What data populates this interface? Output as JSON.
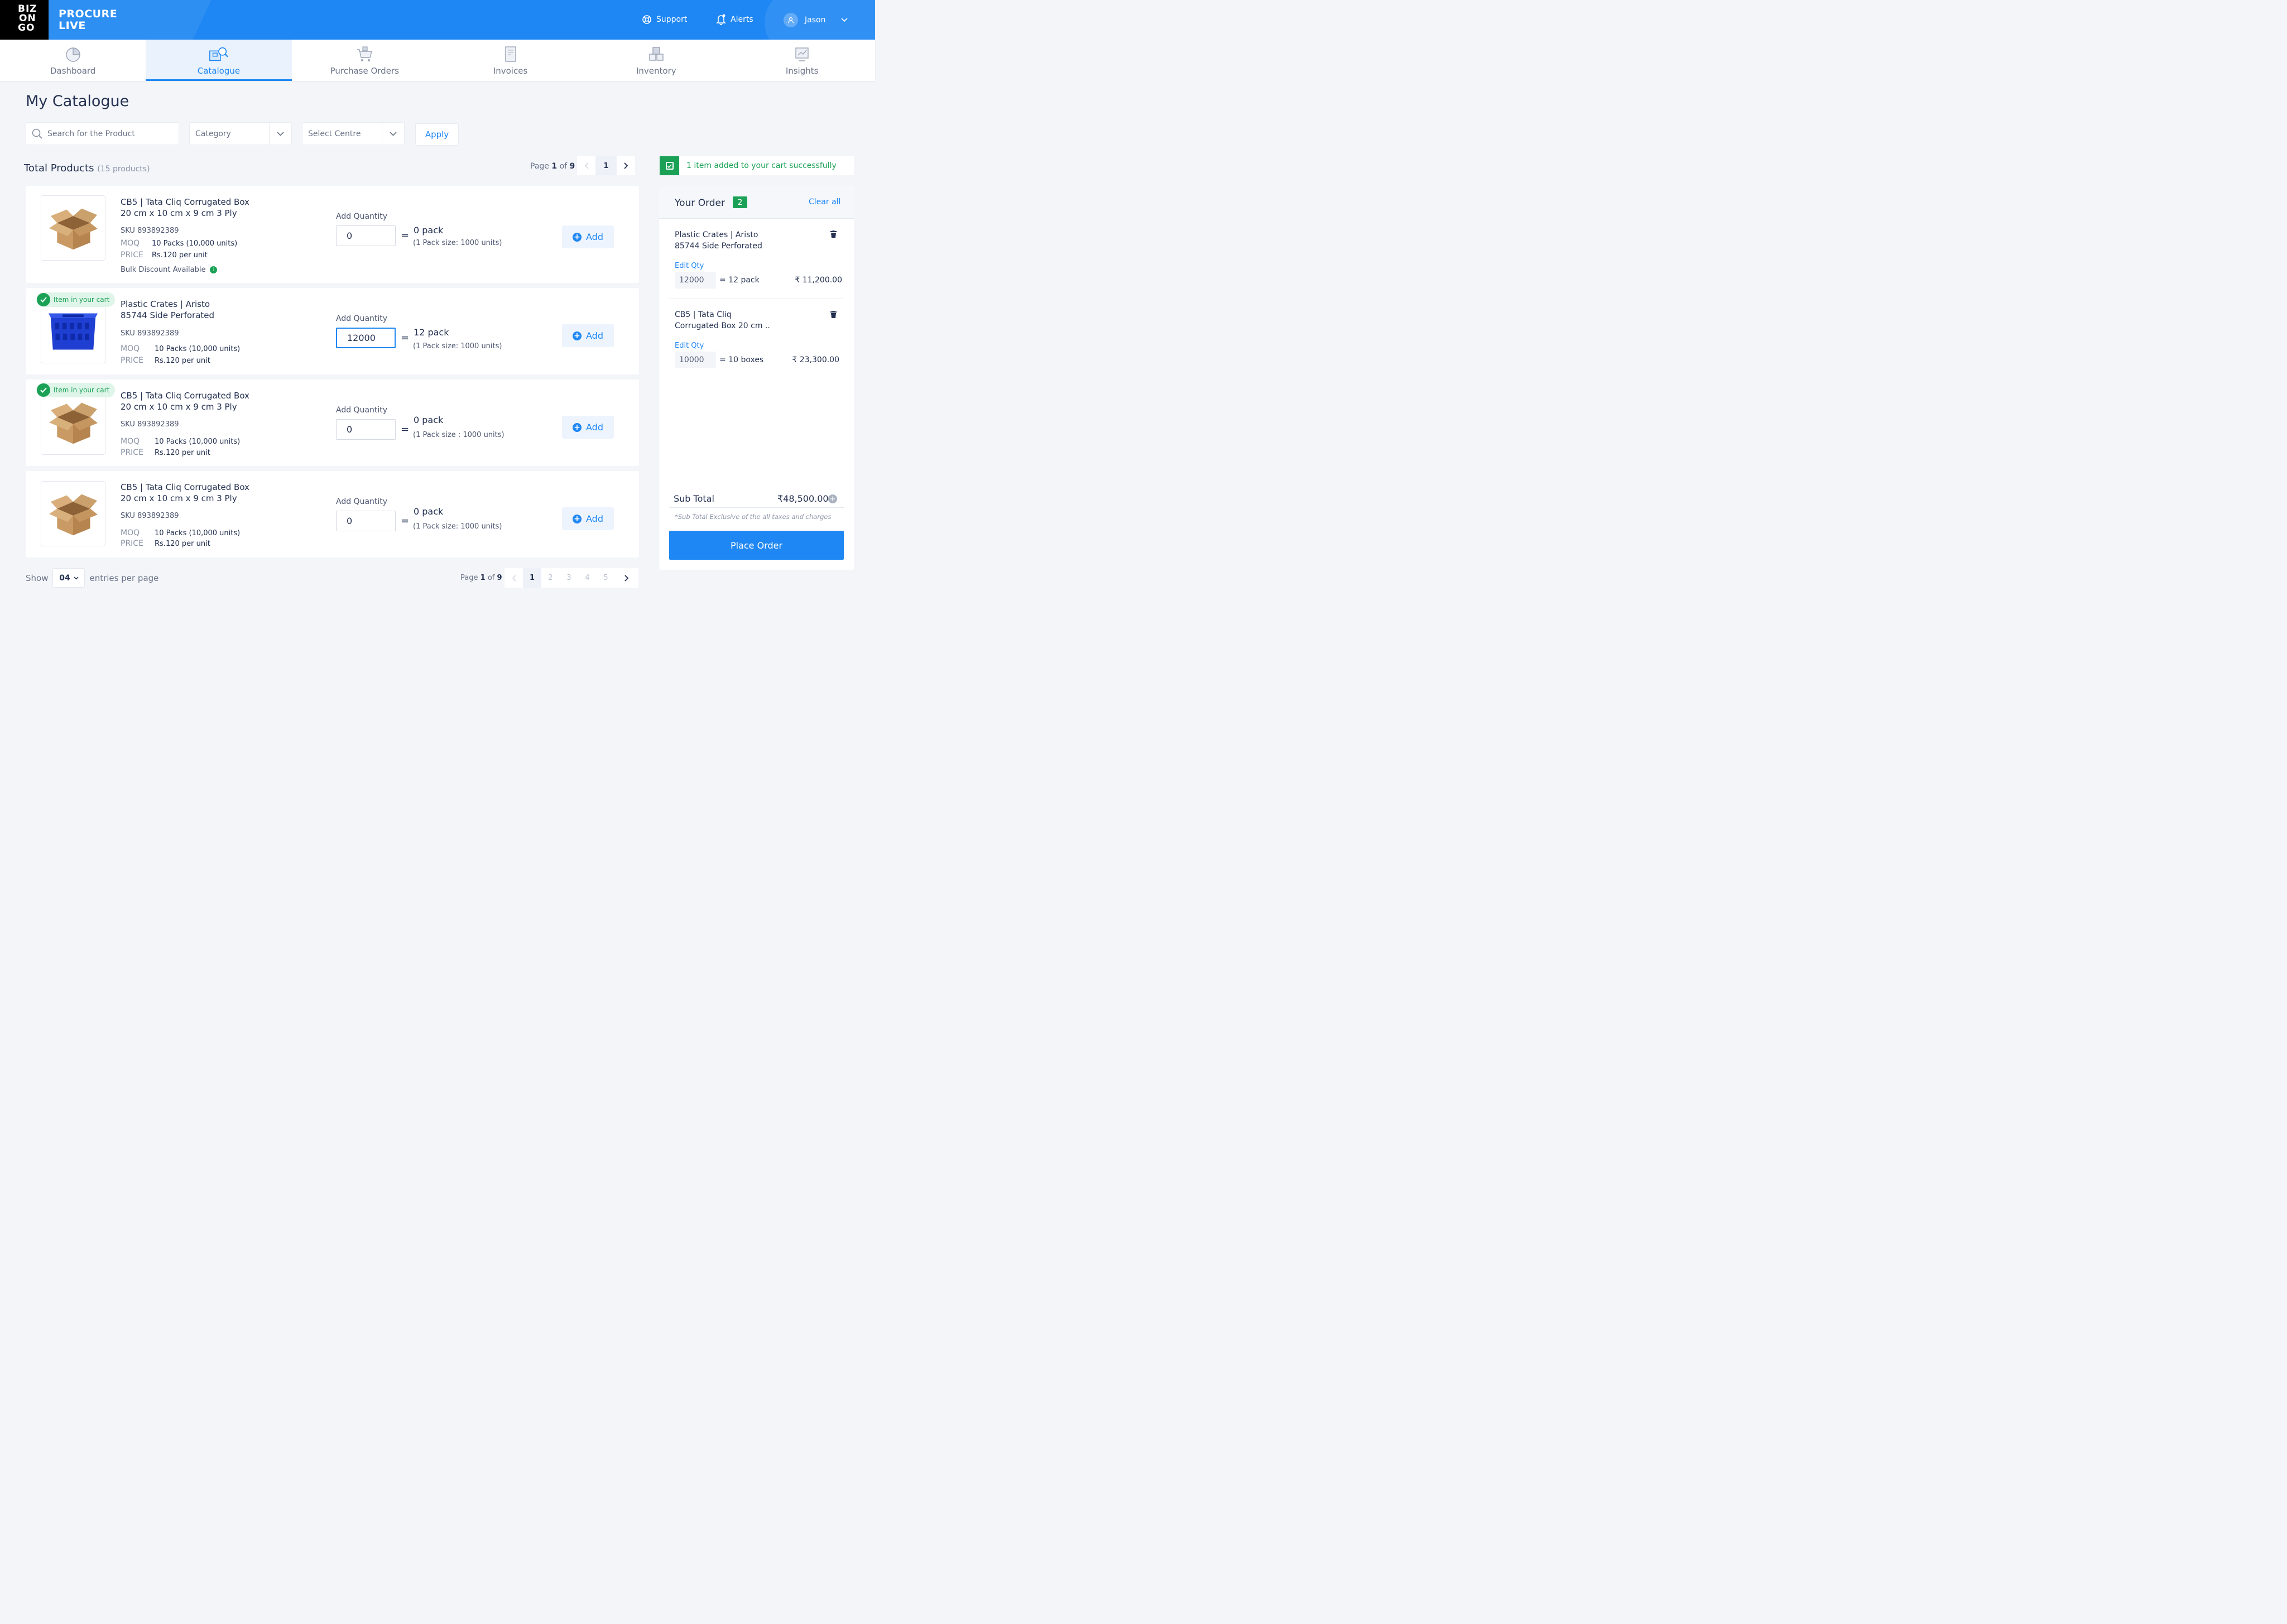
{
  "brand": {
    "logo_lines": [
      "BIZ",
      "ON",
      "GO"
    ],
    "name_line1": "PROCURE",
    "name_line2": "LIVE"
  },
  "header": {
    "support": "Support",
    "alerts": "Alerts",
    "user": "Jason"
  },
  "nav": [
    {
      "label": "Dashboard",
      "icon": "pie-chart-icon",
      "active": false
    },
    {
      "label": "Catalogue",
      "icon": "catalogue-search-icon",
      "active": true
    },
    {
      "label": "Purchase Orders",
      "icon": "cart-icon",
      "active": false
    },
    {
      "label": "Invoices",
      "icon": "invoice-icon",
      "active": false
    },
    {
      "label": "Inventory",
      "icon": "inventory-icon",
      "active": false
    },
    {
      "label": "Insights",
      "icon": "insights-icon",
      "active": false
    }
  ],
  "page": {
    "title": "My Catalogue"
  },
  "filters": {
    "search_placeholder": "Search for the Product",
    "category": "Category",
    "centre": "Select Centre",
    "apply": "Apply"
  },
  "products_header": {
    "title": "Total Products",
    "count": "(15 products)"
  },
  "pagination_top": {
    "page_word": "Page",
    "current": "1",
    "of_word": "of",
    "total": "9",
    "page_button": "1"
  },
  "products": [
    {
      "name_line1": "CB5 | Tata Cliq Corrugated Box",
      "name_line2": "20 cm x 10 cm x 9 cm 3 Ply",
      "sku": "SKU 893892389",
      "moq_label": "MOQ",
      "moq": "10 Packs (10,000 units)",
      "price_label": "PRICE",
      "price": "Rs.120 per unit",
      "bulk": "Bulk Discount Available",
      "qty_label": "Add Quantity",
      "qty": "0",
      "pack": "0 pack",
      "pack_size": "(1 Pack size: 1000 units)",
      "add": "Add",
      "in_cart": false,
      "image": "cardboard-box"
    },
    {
      "name_line1": "Plastic Crates | Aristo",
      "name_line2": "85744 Side Perforated",
      "sku": "SKU 893892389",
      "moq_label": "MOQ",
      "moq": "10 Packs (10,000 units)",
      "price_label": "PRICE",
      "price": "Rs.120 per unit",
      "qty_label": "Add Quantity",
      "qty": "12000",
      "pack": "12 pack",
      "pack_size": "(1 Pack size: 1000 units)",
      "add": "Add",
      "in_cart": true,
      "badge": "Item in your cart",
      "image": "blue-crate"
    },
    {
      "name_line1": "CB5 | Tata Cliq Corrugated Box",
      "name_line2": "20 cm x 10 cm x 9 cm 3 Ply",
      "sku": "SKU 893892389",
      "moq_label": "MOQ",
      "moq": "10 Packs (10,000 units)",
      "price_label": "PRICE",
      "price": "Rs.120 per unit",
      "qty_label": "Add Quantity",
      "qty": "0",
      "pack": "0 pack",
      "pack_size": "(1 Pack size : 1000 units)",
      "add": "Add",
      "in_cart": true,
      "badge": "Item in your cart",
      "image": "cardboard-box"
    },
    {
      "name_line1": "CB5 | Tata Cliq Corrugated Box",
      "name_line2": "20 cm x 10 cm x 9 cm 3 Ply",
      "sku": "SKU 893892389",
      "moq_label": "MOQ",
      "moq": "10 Packs (10,000 units)",
      "price_label": "PRICE",
      "price": "Rs.120 per unit",
      "qty_label": "Add Quantity",
      "qty": "0",
      "pack": "0 pack",
      "pack_size": "(1 Pack size: 1000 units)",
      "add": "Add",
      "in_cart": false,
      "image": "cardboard-box"
    }
  ],
  "footer": {
    "show": "Show",
    "per_page": "04",
    "entries": "entries per page",
    "page_word": "Page",
    "current": "1",
    "of_word": "of",
    "total": "9",
    "pages": [
      "1",
      "2",
      "3",
      "4",
      "5"
    ]
  },
  "toast": {
    "message": "1 item added to your cart successfully"
  },
  "order": {
    "title": "Your Order",
    "count": "2",
    "clear": "Clear all",
    "items": [
      {
        "name_line1": "Plastic Crates | Aristo",
        "name_line2": "85744 Side Perforated",
        "edit": "Edit Qty",
        "qty": "12000",
        "eq": "= 12 pack",
        "amount": "₹ 11,200.00"
      },
      {
        "name_line1": "CB5 | Tata Cliq",
        "name_line2": "Corrugated Box 20 cm ..",
        "edit": "Edit Qty",
        "qty": "10000",
        "eq": "= 10 boxes",
        "amount": "₹ 23,300.00"
      }
    ],
    "subtotal_label": "Sub Total",
    "subtotal": "₹48,500.00",
    "note": "*Sub Total Exclusive of the all taxes and charges",
    "place": "Place Order"
  },
  "colors": {
    "primary": "#1f87f3",
    "success": "#1aa155",
    "background": "#f3f5f9",
    "text": "#233050"
  }
}
